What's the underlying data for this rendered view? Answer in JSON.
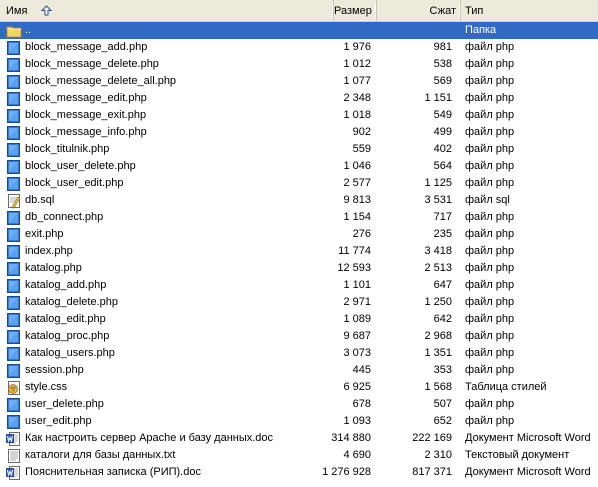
{
  "columns": {
    "name": "Имя",
    "size": "Размер",
    "compressed": "Сжат",
    "type": "Тип"
  },
  "rows": [
    {
      "name": "..",
      "size": "",
      "compressed": "",
      "type": "Папка",
      "icon": "folder-up-icon",
      "selected": true
    },
    {
      "name": "block_message_add.php",
      "size": "1 976",
      "compressed": "981",
      "type": "файл php",
      "icon": "php-file-icon"
    },
    {
      "name": "block_message_delete.php",
      "size": "1 012",
      "compressed": "538",
      "type": "файл php",
      "icon": "php-file-icon"
    },
    {
      "name": "block_message_delete_all.php",
      "size": "1 077",
      "compressed": "569",
      "type": "файл php",
      "icon": "php-file-icon"
    },
    {
      "name": "block_message_edit.php",
      "size": "2 348",
      "compressed": "1 151",
      "type": "файл php",
      "icon": "php-file-icon"
    },
    {
      "name": "block_message_exit.php",
      "size": "1 018",
      "compressed": "549",
      "type": "файл php",
      "icon": "php-file-icon"
    },
    {
      "name": "block_message_info.php",
      "size": "902",
      "compressed": "499",
      "type": "файл php",
      "icon": "php-file-icon"
    },
    {
      "name": "block_titulnik.php",
      "size": "559",
      "compressed": "402",
      "type": "файл php",
      "icon": "php-file-icon"
    },
    {
      "name": "block_user_delete.php",
      "size": "1 046",
      "compressed": "564",
      "type": "файл php",
      "icon": "php-file-icon"
    },
    {
      "name": "block_user_edit.php",
      "size": "2 577",
      "compressed": "1 125",
      "type": "файл php",
      "icon": "php-file-icon"
    },
    {
      "name": "db.sql",
      "size": "9 813",
      "compressed": "3 531",
      "type": "файл sql",
      "icon": "sql-file-icon"
    },
    {
      "name": "db_connect.php",
      "size": "1 154",
      "compressed": "717",
      "type": "файл php",
      "icon": "php-file-icon"
    },
    {
      "name": "exit.php",
      "size": "276",
      "compressed": "235",
      "type": "файл php",
      "icon": "php-file-icon"
    },
    {
      "name": "index.php",
      "size": "11 774",
      "compressed": "3 418",
      "type": "файл php",
      "icon": "php-file-icon"
    },
    {
      "name": "katalog.php",
      "size": "12 593",
      "compressed": "2 513",
      "type": "файл php",
      "icon": "php-file-icon"
    },
    {
      "name": "katalog_add.php",
      "size": "1 101",
      "compressed": "647",
      "type": "файл php",
      "icon": "php-file-icon"
    },
    {
      "name": "katalog_delete.php",
      "size": "2 971",
      "compressed": "1 250",
      "type": "файл php",
      "icon": "php-file-icon"
    },
    {
      "name": "katalog_edit.php",
      "size": "1 089",
      "compressed": "642",
      "type": "файл php",
      "icon": "php-file-icon"
    },
    {
      "name": "katalog_proc.php",
      "size": "9 687",
      "compressed": "2 968",
      "type": "файл php",
      "icon": "php-file-icon"
    },
    {
      "name": "katalog_users.php",
      "size": "3 073",
      "compressed": "1 351",
      "type": "файл php",
      "icon": "php-file-icon"
    },
    {
      "name": "session.php",
      "size": "445",
      "compressed": "353",
      "type": "файл php",
      "icon": "php-file-icon"
    },
    {
      "name": "style.css",
      "size": "6 925",
      "compressed": "1 568",
      "type": "Таблица стилей",
      "icon": "css-file-icon"
    },
    {
      "name": "user_delete.php",
      "size": "678",
      "compressed": "507",
      "type": "файл php",
      "icon": "php-file-icon"
    },
    {
      "name": "user_edit.php",
      "size": "1 093",
      "compressed": "652",
      "type": "файл php",
      "icon": "php-file-icon"
    },
    {
      "name": "Как настроить сервер Apache и базу данных.doc",
      "size": "314 880",
      "compressed": "222 169",
      "type": "Документ Microsoft Word",
      "icon": "word-doc-icon"
    },
    {
      "name": "каталоги для базы данных.txt",
      "size": "4 690",
      "compressed": "2 310",
      "type": "Текстовый документ",
      "icon": "text-file-icon"
    },
    {
      "name": "Пояснительная записка (РИП).doc",
      "size": "1 276 928",
      "compressed": "817 371",
      "type": "Документ Microsoft Word",
      "icon": "word-doc-icon"
    }
  ]
}
